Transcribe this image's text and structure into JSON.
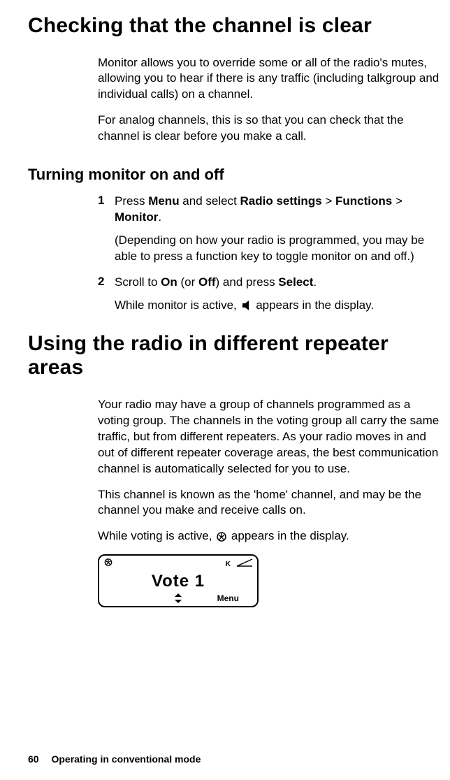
{
  "section1": {
    "heading": "Checking that the channel is clear",
    "para1": "Monitor allows you to override some or all of the radio's mutes, allowing you to hear if there is any traffic (including talkgroup and individual calls) on a channel.",
    "para2": "For analog channels, this is so that you can check that the channel is clear before you make a call."
  },
  "subsection": {
    "heading": "Turning monitor on and off",
    "step1_num": "1",
    "step1_a": "Press ",
    "step1_b": "Menu",
    "step1_c": " and select ",
    "step1_d": "Radio settings",
    "step1_e": " > ",
    "step1_f": "Functions",
    "step1_g": " > ",
    "step1_h": "Monitor",
    "step1_i": ".",
    "step1_note": "(Depending on how your radio is programmed, you may be able to press a function key to toggle monitor on and off.)",
    "step2_num": "2",
    "step2_a": "Scroll to ",
    "step2_b": "On",
    "step2_c": " (or ",
    "step2_d": "Off",
    "step2_e": ") and press ",
    "step2_f": "Select",
    "step2_g": ".",
    "step2_note_a": "While monitor is active, ",
    "step2_note_b": " appears in the display."
  },
  "section2": {
    "heading": "Using the radio in different repeater areas",
    "para1": "Your radio may have a group of channels programmed as a voting group. The channels in the voting group all carry the same traffic, but from different repeaters. As your radio moves in and out of different repeater coverage areas, the best communication channel is automatically selected for you to use.",
    "para2": "This channel is known as the 'home' channel, and may be the channel you make and receive calls on.",
    "para3_a": "While voting is active, ",
    "para3_b": " appears in the display."
  },
  "radio_display": {
    "channel": "Vote 1",
    "softkey_right": "Menu",
    "rssi_label": "K"
  },
  "footer": {
    "page": "60",
    "title": "Operating in conventional mode"
  }
}
